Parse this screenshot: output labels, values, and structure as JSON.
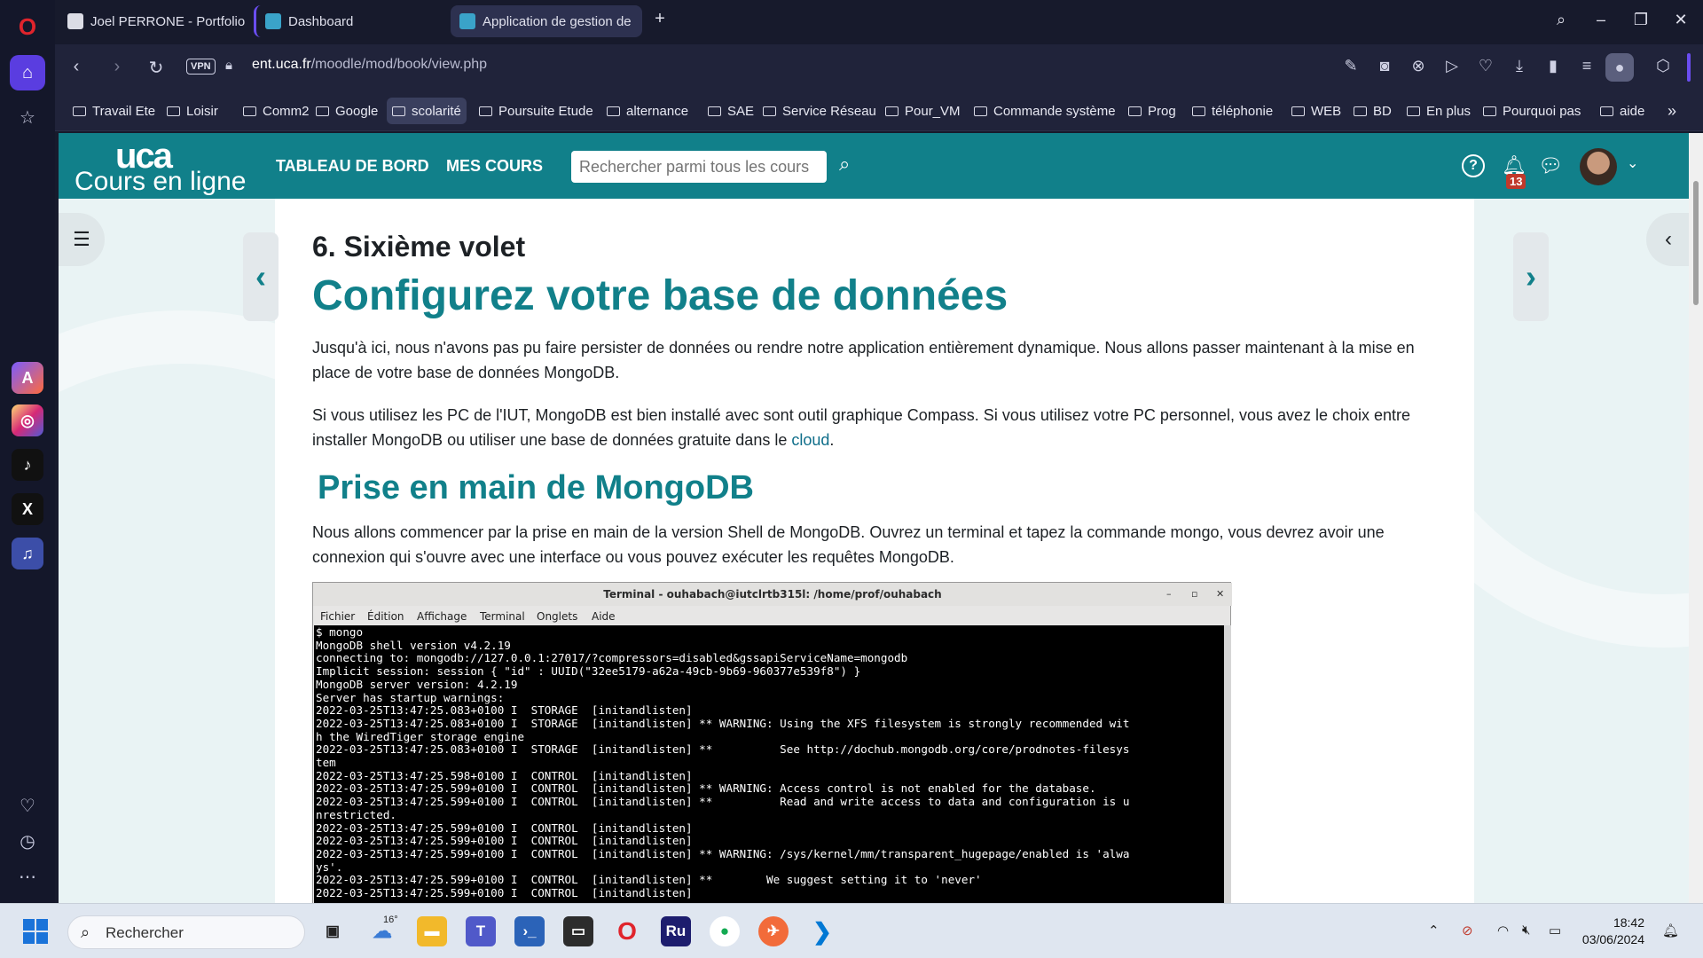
{
  "browser": {
    "tabs": [
      {
        "label": "Joel PERRONE - Portfolio",
        "active": false
      },
      {
        "label": "Dashboard",
        "active": false
      },
      {
        "label": "Application de gestion de",
        "active": true
      }
    ],
    "url_host": "ent.uca.fr",
    "url_path": "/moodle/mod/book/view.php",
    "vpn_label": "VPN",
    "bookmarks": [
      "Travail Ete",
      "Loisir",
      "Comm2",
      "Google",
      "scolarité",
      "Poursuite Etude",
      "alternance",
      "SAE",
      "Service Réseau",
      "Pour_VM",
      "Commande système",
      "Prog",
      "téléphonie",
      "WEB",
      "BD",
      "En plus",
      "Pourquoi pas",
      "aide"
    ],
    "active_bookmark": "scolarité"
  },
  "moodle": {
    "logo_mark": "uca",
    "logo_text": "Cours en ligne",
    "nav_dashboard": "TABLEAU DE BORD",
    "nav_courses": "MES COURS",
    "search_placeholder": "Rechercher parmi tous les cours",
    "notification_count": "13"
  },
  "content": {
    "chapter_title": "6. Sixième volet",
    "heading": "Configurez votre base de données",
    "para1": "Jusqu'à ici, nous n'avons pas pu faire persister de données ou rendre notre application entièrement dynamique. Nous allons passer maintenant à la mise en place de votre base de données MongoDB.",
    "para2_before": "Si vous utilisez les PC de l'IUT, MongoDB est bien installé avec sont outil graphique Compass. Si vous utilisez votre PC personnel, vous avez le choix entre installer MongoDB ou utiliser une base de données gratuite dans le ",
    "para2_link": "cloud",
    "para2_after": ".",
    "subheading": "Prise en main de MongoDB",
    "para3": "Nous allons commencer par la prise en main de la version Shell de MongoDB. Ouvrez un terminal et tapez la commande mongo, vous devrez avoir une connexion qui s'ouvre avec une interface ou vous pouvez exécuter les requêtes MongoDB."
  },
  "terminal": {
    "title": "Terminal - ouhabach@iutclrtb315l: /home/prof/ouhabach",
    "menu": [
      "Fichier",
      "Édition",
      "Affichage",
      "Terminal",
      "Onglets",
      "Aide"
    ],
    "lines": [
      "$ mongo",
      "MongoDB shell version v4.2.19",
      "connecting to: mongodb://127.0.0.1:27017/?compressors=disabled&gssapiServiceName=mongodb",
      "Implicit session: session { \"id\" : UUID(\"32ee5179-a62a-49cb-9b69-960377e539f8\") }",
      "MongoDB server version: 4.2.19",
      "Server has startup warnings:",
      "2022-03-25T13:47:25.083+0100 I  STORAGE  [initandlisten]",
      "2022-03-25T13:47:25.083+0100 I  STORAGE  [initandlisten] ** WARNING: Using the XFS filesystem is strongly recommended wit",
      "h the WiredTiger storage engine",
      "2022-03-25T13:47:25.083+0100 I  STORAGE  [initandlisten] **          See http://dochub.mongodb.org/core/prodnotes-filesys",
      "tem",
      "2022-03-25T13:47:25.598+0100 I  CONTROL  [initandlisten]",
      "2022-03-25T13:47:25.599+0100 I  CONTROL  [initandlisten] ** WARNING: Access control is not enabled for the database.",
      "2022-03-25T13:47:25.599+0100 I  CONTROL  [initandlisten] **          Read and write access to data and configuration is u",
      "nrestricted.",
      "2022-03-25T13:47:25.599+0100 I  CONTROL  [initandlisten]",
      "2022-03-25T13:47:25.599+0100 I  CONTROL  [initandlisten]",
      "2022-03-25T13:47:25.599+0100 I  CONTROL  [initandlisten] ** WARNING: /sys/kernel/mm/transparent_hugepage/enabled is 'alwa",
      "ys'.",
      "2022-03-25T13:47:25.599+0100 I  CONTROL  [initandlisten] **        We suggest setting it to 'never'",
      "2022-03-25T13:47:25.599+0100 I  CONTROL  [initandlisten]"
    ]
  },
  "taskbar": {
    "search_label": "Rechercher",
    "weather_temp": "16°",
    "time": "18:42",
    "date": "03/06/2024",
    "apps": [
      "task-view",
      "weather",
      "file-explorer",
      "teams",
      "powershell",
      "terminal",
      "opera",
      "rufus",
      "mongodb-compass",
      "postman",
      "vscode"
    ]
  }
}
